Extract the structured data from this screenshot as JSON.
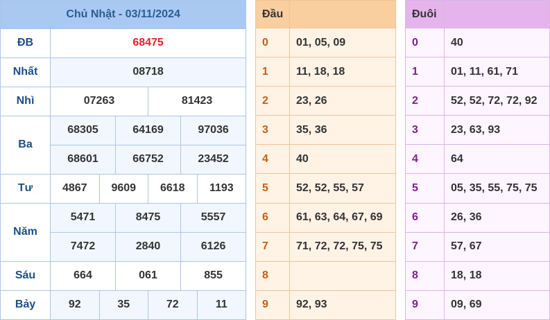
{
  "results": {
    "header": "Chủ Nhật - 03/11/2024",
    "db": {
      "label": "ĐB",
      "values": [
        "68475"
      ]
    },
    "nhat": {
      "label": "Nhất",
      "values": [
        "08718"
      ]
    },
    "nhi": {
      "label": "Nhì",
      "values": [
        "07263",
        "81423"
      ]
    },
    "ba": {
      "label": "Ba",
      "values": [
        "68305",
        "64169",
        "97036",
        "68601",
        "66752",
        "23452"
      ]
    },
    "tu": {
      "label": "Tư",
      "values": [
        "4867",
        "9609",
        "6618",
        "1193"
      ]
    },
    "nam": {
      "label": "Năm",
      "values": [
        "5471",
        "8475",
        "5557",
        "7472",
        "2840",
        "6126"
      ]
    },
    "sau": {
      "label": "Sáu",
      "values": [
        "664",
        "061",
        "855"
      ]
    },
    "bay": {
      "label": "Bảy",
      "values": [
        "92",
        "35",
        "72",
        "11"
      ]
    }
  },
  "dau": {
    "header": "Đầu",
    "rows": [
      {
        "index": "0",
        "values": "01, 05, 09"
      },
      {
        "index": "1",
        "values": "11, 18, 18"
      },
      {
        "index": "2",
        "values": "23, 26"
      },
      {
        "index": "3",
        "values": "35, 36"
      },
      {
        "index": "4",
        "values": "40"
      },
      {
        "index": "5",
        "values": "52, 52, 55, 57"
      },
      {
        "index": "6",
        "values": "61, 63, 64, 67, 69"
      },
      {
        "index": "7",
        "values": "71, 72, 72, 75, 75"
      },
      {
        "index": "8",
        "values": ""
      },
      {
        "index": "9",
        "values": "92, 93"
      }
    ]
  },
  "duoi": {
    "header": "Đuôi",
    "rows": [
      {
        "index": "0",
        "values": "40"
      },
      {
        "index": "1",
        "values": "01, 11, 61, 71"
      },
      {
        "index": "2",
        "values": "52, 52, 72, 72, 92"
      },
      {
        "index": "3",
        "values": "23, 63, 93"
      },
      {
        "index": "4",
        "values": "64"
      },
      {
        "index": "5",
        "values": "05, 35, 55, 75, 75"
      },
      {
        "index": "6",
        "values": "26, 36"
      },
      {
        "index": "7",
        "values": "57, 67"
      },
      {
        "index": "8",
        "values": "18, 18"
      },
      {
        "index": "9",
        "values": "09, 69"
      }
    ]
  }
}
